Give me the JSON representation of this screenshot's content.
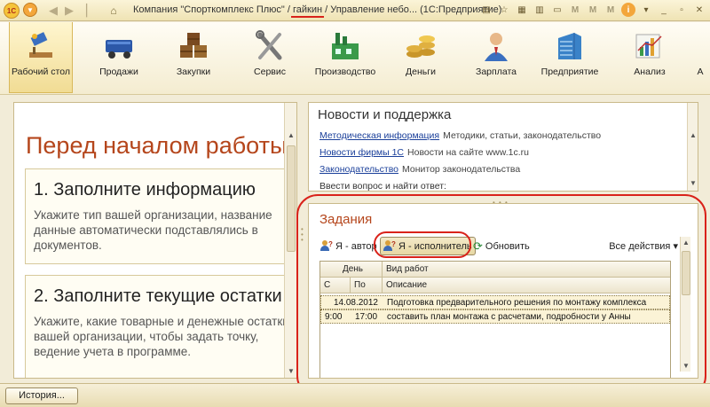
{
  "window": {
    "title_prefix": "Компания \"Спорткомплекс Плюс\" / ",
    "title_user": "гайкин",
    "title_suffix": " / Управление небо... (1С:Предприятие)",
    "logo_text": "1C"
  },
  "sections": [
    {
      "label": "Рабочий стол",
      "icon": "desktop-icon"
    },
    {
      "label": "Продажи",
      "icon": "sales-icon"
    },
    {
      "label": "Закупки",
      "icon": "purchases-icon"
    },
    {
      "label": "Сервис",
      "icon": "service-icon"
    },
    {
      "label": "Производство",
      "icon": "production-icon"
    },
    {
      "label": "Деньги",
      "icon": "money-icon"
    },
    {
      "label": "Зарплата",
      "icon": "salary-icon"
    },
    {
      "label": "Предприятие",
      "icon": "enterprise-icon"
    },
    {
      "label": "Анализ",
      "icon": "analysis-icon"
    },
    {
      "label": "А",
      "icon": "more-icon"
    }
  ],
  "left": {
    "title": "Перед началом работы",
    "step1_title": "1. Заполните информацию",
    "step1_lines": [
      "Укажите тип вашей организации, название",
      "данные автоматически подставлялись в",
      "документов."
    ],
    "step2_title": "2. Заполните текущие остатки",
    "step2_lines": [
      "Укажите, какие товарные и денежные остатки",
      "вашей организации, чтобы задать точку,",
      "ведение учета в программе."
    ]
  },
  "news": {
    "title": "Новости и поддержка",
    "rows": [
      {
        "link": "Методическая информация",
        "desc": "Методики, статьи, законодательство"
      },
      {
        "link": "Новости фирмы 1С",
        "desc": "Новости на сайте www.1c.ru"
      },
      {
        "link": "Законодательство",
        "desc": "Монитор законодательства"
      }
    ],
    "cut_text": "Ввести вопрос и найти ответ:"
  },
  "tasks": {
    "title": "Задания",
    "btn_author": "Я - автор",
    "btn_executor": "Я - исполнитель",
    "btn_refresh": "Обновить",
    "all_actions": "Все действия",
    "hdr_day": "День",
    "hdr_worktype": "Вид работ",
    "hdr_from": "С",
    "hdr_to": "По",
    "hdr_desc": "Описание",
    "row": {
      "date": "14.08.2012",
      "from": "9:00",
      "to": "17:00",
      "worktype": "Подготовка предварительного решения по монтажу комплекса",
      "desc": "составить план монтажа с расчетами, подробности у Анны"
    }
  },
  "bottom": {
    "history": "История..."
  }
}
